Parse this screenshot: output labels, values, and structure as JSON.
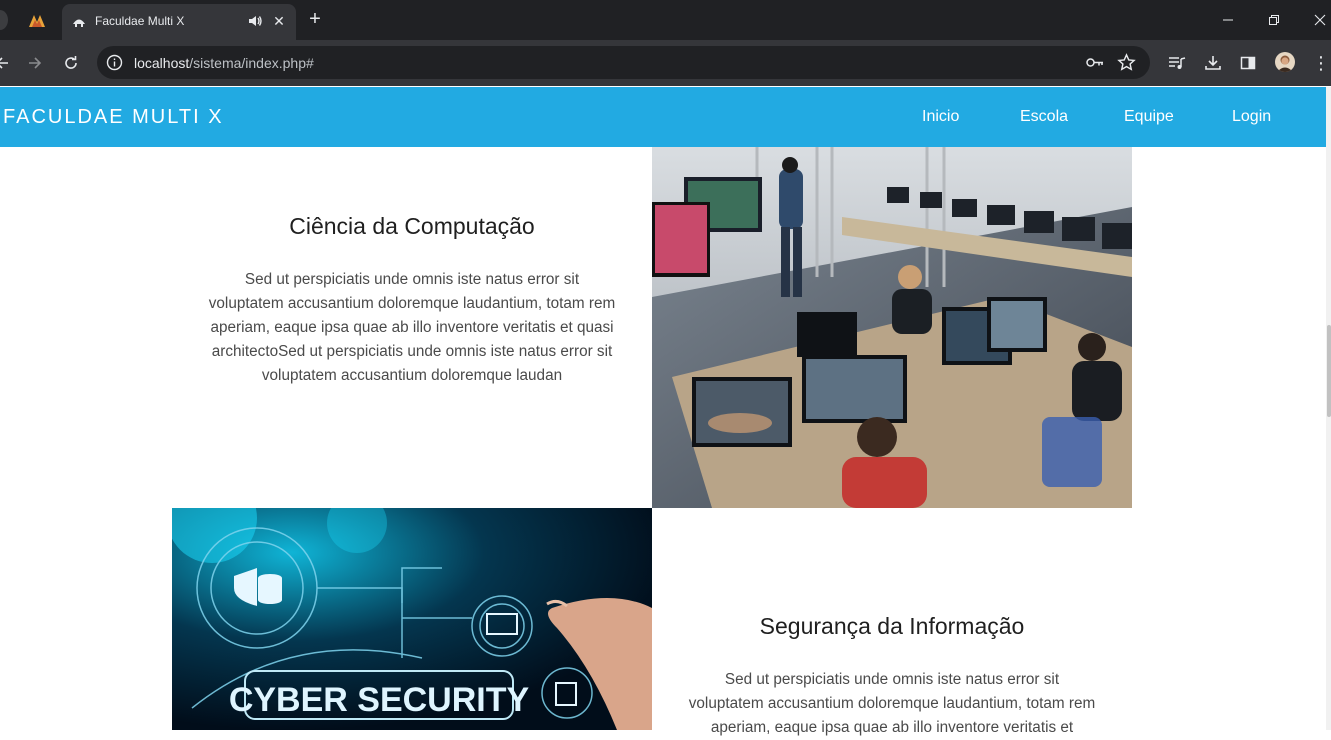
{
  "browser": {
    "tab_title": "Faculdae Multi X",
    "url_host": "localhost",
    "url_path": "/sistema/index.php#",
    "new_tab": "+",
    "close_tab": "✕",
    "menu": "⋮"
  },
  "site": {
    "brand": "FACULDAE MULTI X",
    "nav": [
      "Inicio",
      "Escola",
      "Equipe",
      "Login"
    ],
    "accent": "#22aae2"
  },
  "sections": [
    {
      "title": "Ciência da Computação",
      "text": "Sed ut perspiciatis unde omnis iste natus error sit voluptatem accusantium doloremque laudantium, totam rem aperiam, eaque ipsa quae ab illo inventore veritatis et quasi architectoSed ut perspiciatis unde omnis iste natus error sit voluptatem accusantium doloremque laudan"
    },
    {
      "title": "Segurança da Informação",
      "text": "Sed ut perspiciatis unde omnis iste natus error sit voluptatem accusantium doloremque laudantium, totam rem aperiam, eaque ipsa quae ab illo inventore veritatis et",
      "image_text": "CYBER SECURITY"
    }
  ]
}
